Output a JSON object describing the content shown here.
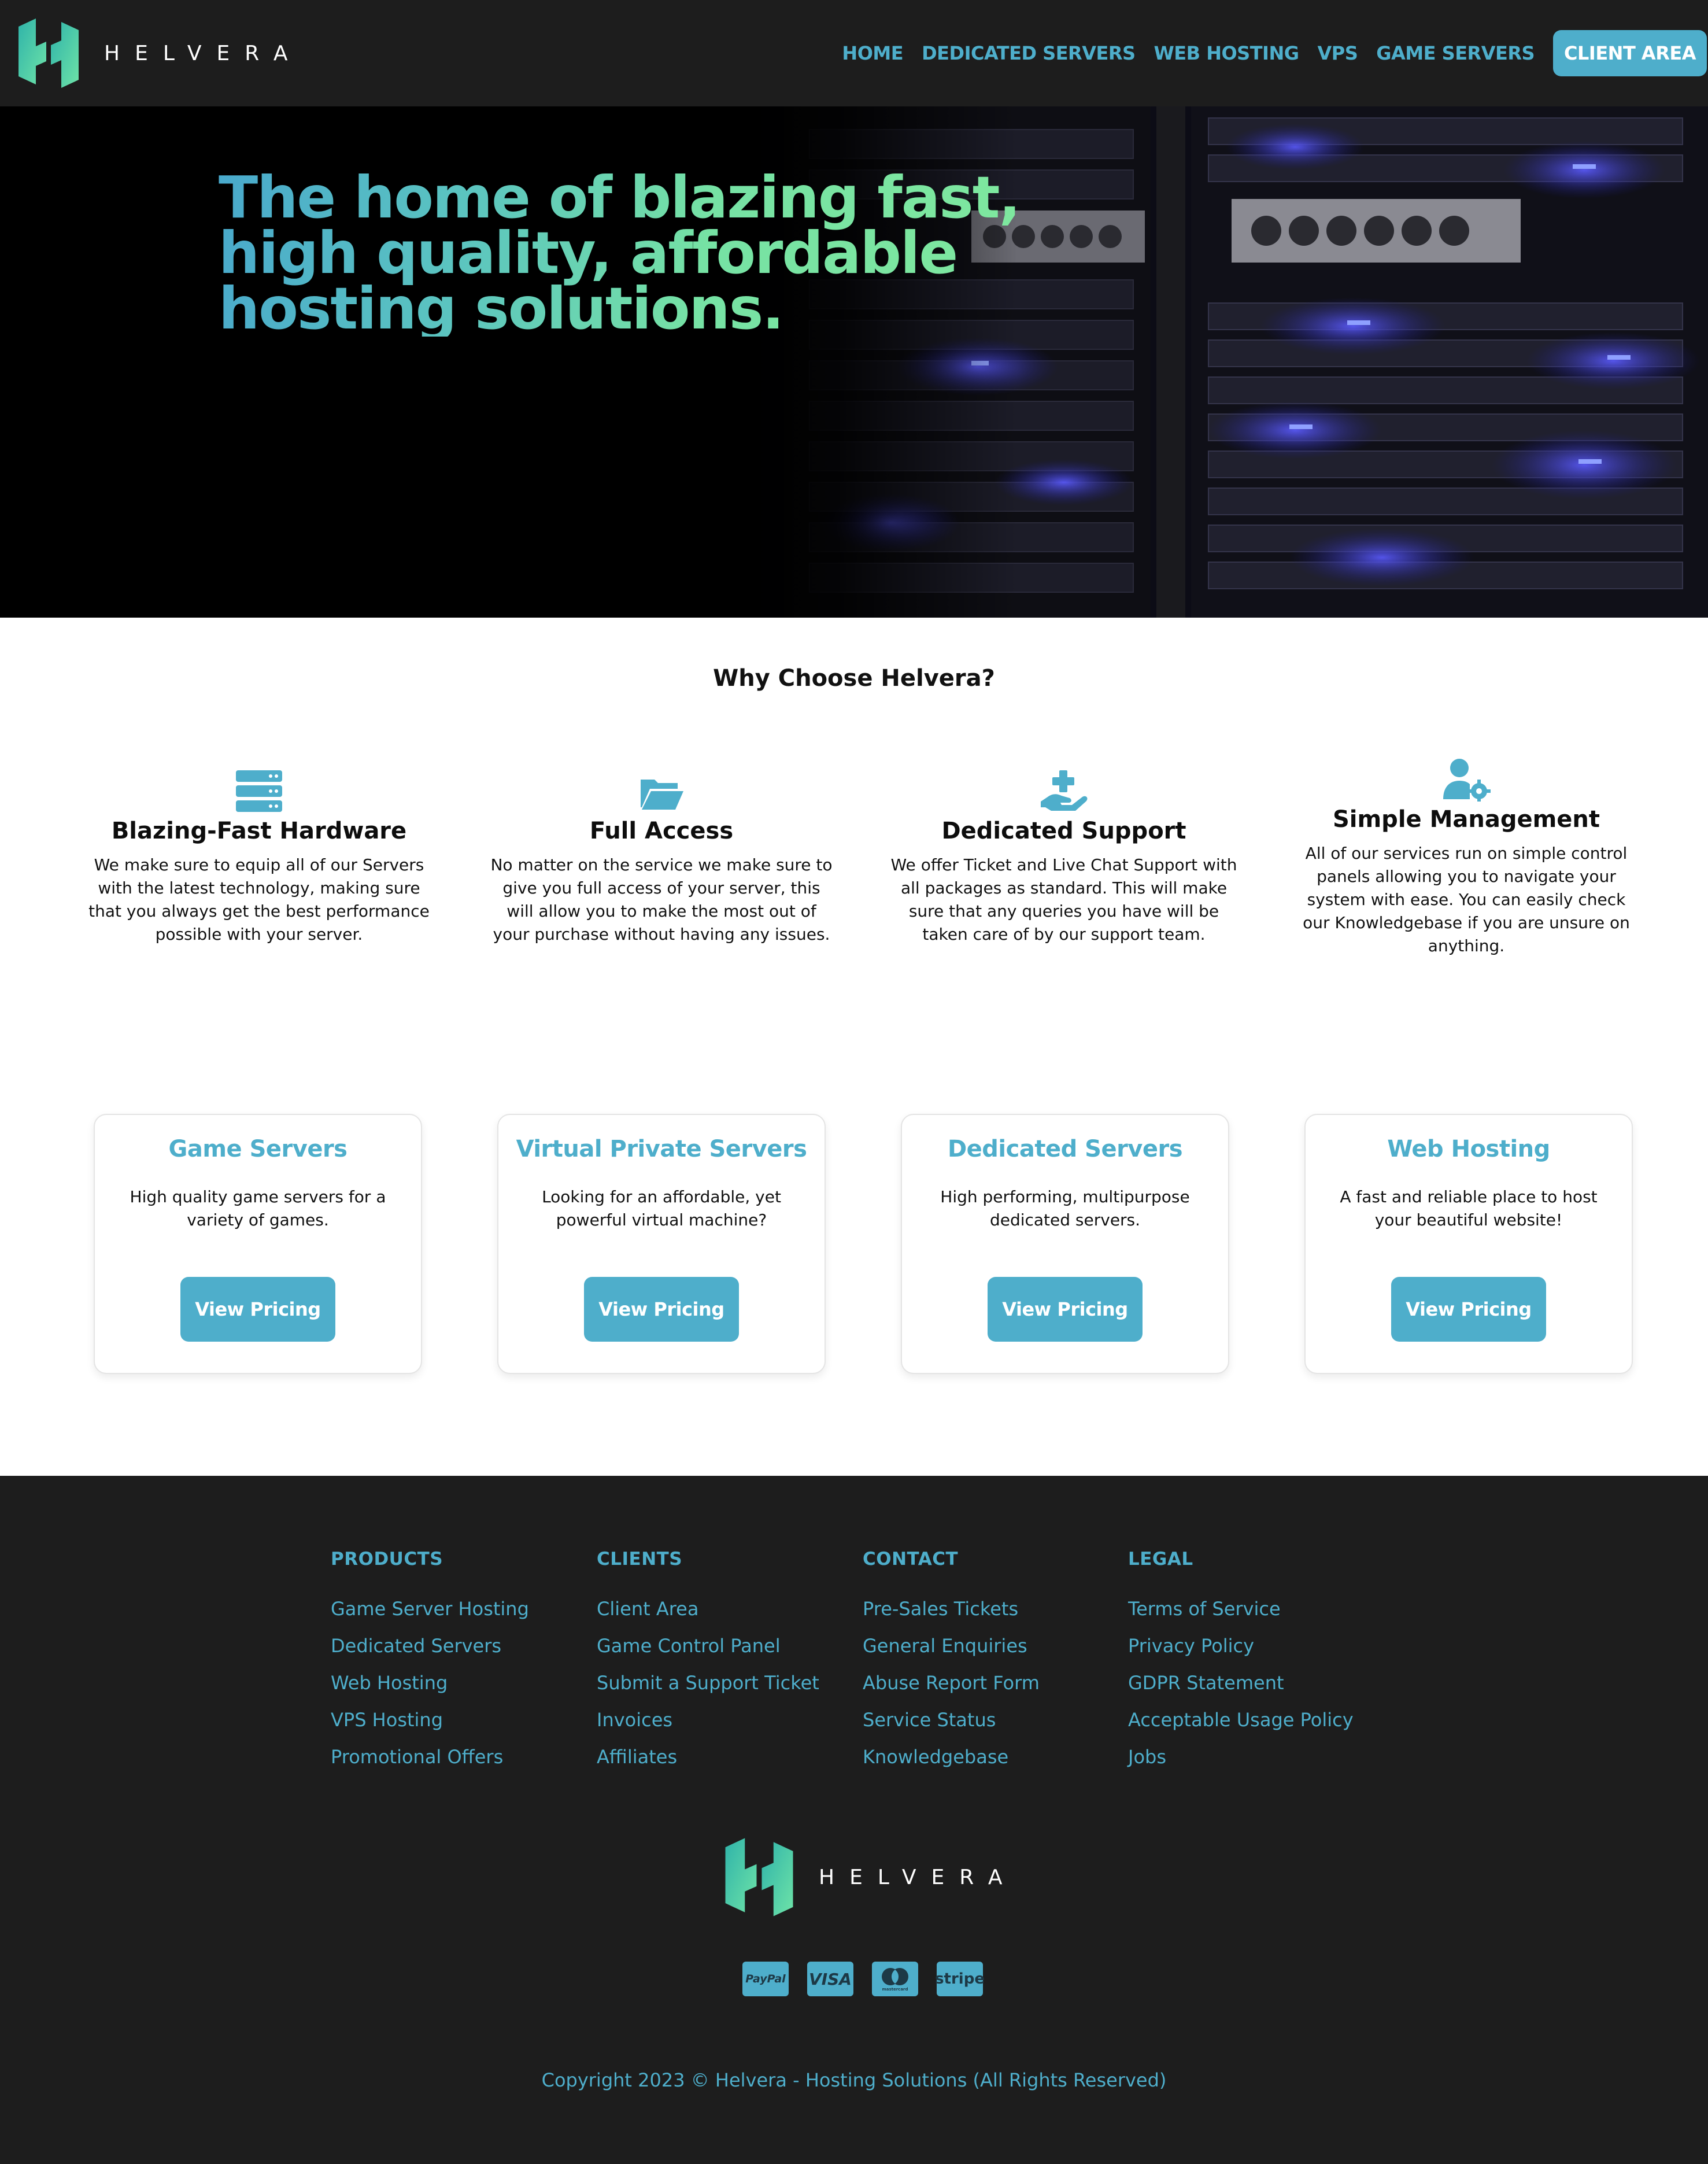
{
  "colors": {
    "accent": "#4eaecb",
    "dark": "#1d1d1d",
    "gradient_start": "#49a9cc",
    "gradient_end": "#7fe89e"
  },
  "brand": {
    "name": "HELVERA"
  },
  "nav": {
    "items": [
      {
        "label": "HOME"
      },
      {
        "label": "DEDICATED SERVERS"
      },
      {
        "label": "WEB HOSTING"
      },
      {
        "label": "VPS"
      },
      {
        "label": "GAME SERVERS"
      }
    ],
    "cta": "CLIENT AREA"
  },
  "hero": {
    "line1": "The home of blazing fast,",
    "line2": "high quality, affordable",
    "line3": "hosting solutions."
  },
  "why": {
    "title": "Why Choose Helvera?",
    "features": [
      {
        "icon": "server-icon",
        "title": "Blazing-Fast Hardware",
        "text": "We make sure to equip all of our Servers with the latest technology, making sure that you always get the best performance possible with your server."
      },
      {
        "icon": "folder-open-icon",
        "title": "Full Access",
        "text": "No matter on the service we make sure to give you full access of your server, this will allow you to make the most out of your purchase without having any issues."
      },
      {
        "icon": "hand-holding-medical-icon",
        "title": "Dedicated Support",
        "text": "We offer Ticket and Live Chat Support with all packages as standard. This will make sure that any queries you have will be taken care of by our support team."
      },
      {
        "icon": "user-cog-icon",
        "title": "Simple Management",
        "text": "All of our services run on simple control panels allowing you to navigate your system with ease. You can easily check our Knowledgebase if you are unsure on anything."
      }
    ]
  },
  "products": [
    {
      "title": "Game Servers",
      "text": "High quality game servers for a variety of games.",
      "button": "View Pricing"
    },
    {
      "title": "Virtual Private Servers",
      "text": "Looking for an affordable, yet powerful virtual machine?",
      "button": "View Pricing"
    },
    {
      "title": "Dedicated Servers",
      "text": "High performing, multipurpose dedicated servers.",
      "button": "View Pricing"
    },
    {
      "title": "Web Hosting",
      "text": "A fast and reliable place to host your beautiful website!",
      "button": "View Pricing"
    }
  ],
  "footer": {
    "columns": [
      {
        "heading": "PRODUCTS",
        "links": [
          "Game Server Hosting",
          "Dedicated Servers",
          "Web Hosting",
          "VPS Hosting",
          "Promotional Offers"
        ]
      },
      {
        "heading": "CLIENTS",
        "links": [
          "Client Area",
          "Game Control Panel",
          "Submit a Support Ticket",
          "Invoices",
          "Affiliates"
        ]
      },
      {
        "heading": "CONTACT",
        "links": [
          "Pre-Sales Tickets",
          "General Enquiries",
          "Abuse Report Form",
          "Service Status",
          "Knowledgebase"
        ]
      },
      {
        "heading": "LEGAL",
        "links": [
          "Terms of Service",
          "Privacy Policy",
          "GDPR Statement",
          "Acceptable Usage Policy",
          "Jobs"
        ]
      }
    ],
    "payments": {
      "paypal": "PayPal",
      "visa": "VISA",
      "mastercard": "mastercard",
      "stripe": "stripe"
    },
    "copyright": "Copyright 2023 © Helvera - Hosting Solutions (All Rights Reserved)"
  }
}
